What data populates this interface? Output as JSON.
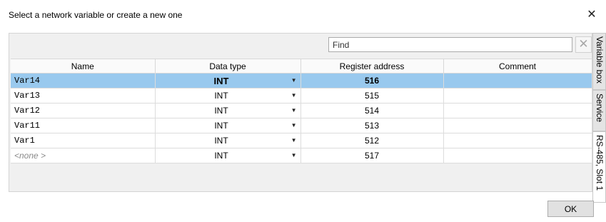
{
  "window": {
    "title": "Select a network variable or create a new one",
    "close_icon": "close-icon"
  },
  "find": {
    "value": "Find",
    "clear_icon": "clear-icon",
    "clear_glyph": "✕"
  },
  "table": {
    "columns": [
      "Name",
      "Data type",
      "Register address",
      "Comment"
    ],
    "rows": [
      {
        "name": "Var14",
        "type": "INT",
        "register": "516",
        "comment": "",
        "selected": true
      },
      {
        "name": "Var13",
        "type": "INT",
        "register": "515",
        "comment": "",
        "selected": false
      },
      {
        "name": "Var12",
        "type": "INT",
        "register": "514",
        "comment": "",
        "selected": false
      },
      {
        "name": "Var11",
        "type": "INT",
        "register": "513",
        "comment": "",
        "selected": false
      },
      {
        "name": "Var1",
        "type": "INT",
        "register": "512",
        "comment": "",
        "selected": false
      },
      {
        "name": "<none >",
        "type": "INT",
        "register": "517",
        "comment": "",
        "selected": false
      }
    ],
    "selected_color": "#99c9ee"
  },
  "side_tabs": [
    {
      "label": "Variable box"
    },
    {
      "label": "Service"
    },
    {
      "label": "RS-485, Slot 1"
    }
  ],
  "footer": {
    "ok_label": "OK"
  }
}
